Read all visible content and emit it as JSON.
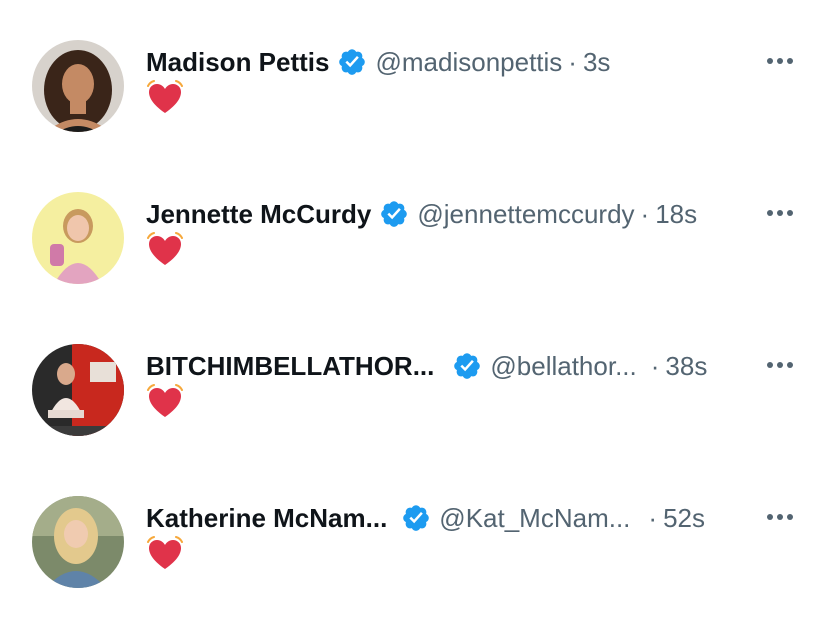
{
  "tweets": [
    {
      "name": "Madison Pettis",
      "handle": "@madisonpettis",
      "time": "3s",
      "avatar_icon": "avatar-madison-pettis",
      "reaction_icon": "beating-heart-emoji"
    },
    {
      "name": "Jennette McCurdy",
      "handle": "@jennettemccurdy",
      "time": "18s",
      "avatar_icon": "avatar-jennette-mccurdy",
      "reaction_icon": "beating-heart-emoji"
    },
    {
      "name": "BITCHIMBELLATHOR...",
      "handle": "@bellathor...",
      "time": "38s",
      "avatar_icon": "avatar-bella-thorne",
      "reaction_icon": "beating-heart-emoji"
    },
    {
      "name": "Katherine McNam...",
      "handle": "@Kat_McNam...",
      "time": "52s",
      "avatar_icon": "avatar-katherine-mcnamara",
      "reaction_icon": "beating-heart-emoji"
    }
  ],
  "separator": "·",
  "colors": {
    "text_primary": "#0f1419",
    "text_secondary": "#536471",
    "verified": "#1d9bf0",
    "heart": "#e0334a"
  }
}
